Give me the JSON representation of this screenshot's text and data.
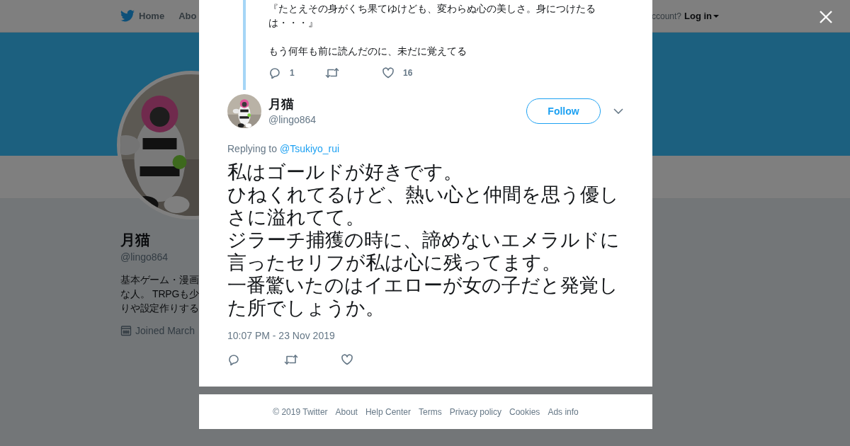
{
  "background_page": {
    "nav": {
      "items": [
        {
          "label": "Home",
          "kind": "home"
        },
        {
          "label": "Abo",
          "kind": "plain"
        }
      ],
      "login_prompt": "ccount?",
      "login": "Log in"
    },
    "profile": {
      "name": "月猫",
      "handle": "@lingo864",
      "bio_lines": [
        "基本ゲーム・漫画",
        "な人。 TRPGも少",
        "りや設定作りする"
      ],
      "joined": "Joined March"
    }
  },
  "modal": {
    "parent_tweet": {
      "paragraphs": [
        "『たとえその身がくち果てゆけども、変わらぬ心の美しさ。身につけたるは・・・』",
        "もう何年も前に読んだのに、未だに覚えてる"
      ],
      "actions": [
        {
          "kind": "reply",
          "count": "1"
        },
        {
          "kind": "retweet"
        },
        {
          "kind": "like",
          "count": "16"
        }
      ]
    },
    "tweet": {
      "name": "月猫",
      "handle": "@lingo864",
      "follow": "Follow",
      "replying_label": "Replying to",
      "reply_to": "@Tsukiyo_rui",
      "text_lines": [
        "私はゴールドが好きです。",
        "ひねくれてるけど、熱い心と仲間を思う優しさに溢れてて。",
        "ジラーチ捕獲の時に、諦めないエメラルドに言ったセリフが私は心に残ってます。",
        "一番驚いたのはイエローが女の子だと発覚した所でしょうか。"
      ],
      "timestamp": "10:07 PM - 23 Nov 2019",
      "actions": [
        {
          "kind": "reply"
        },
        {
          "kind": "retweet"
        },
        {
          "kind": "like"
        }
      ]
    }
  },
  "footer": {
    "links": [
      "© 2019 Twitter",
      "About",
      "Help Center",
      "Terms",
      "Privacy policy",
      "Cookies",
      "Ads info"
    ]
  }
}
